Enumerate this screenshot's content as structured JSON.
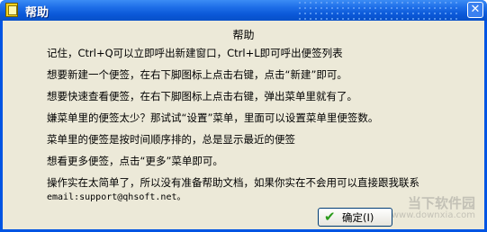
{
  "window": {
    "title": "帮助",
    "close_glyph": "✕"
  },
  "dialog": {
    "heading": "帮助",
    "lines": [
      "记住，Ctrl+Q可以立即呼出新建窗口，Ctrl+L即可呼出便签列表",
      "想要新建一个便签，在右下脚图标上点击右键，点击“新建”即可。",
      "想要快速查看便签，在右下脚图标上点击右键，弹出菜单里就有了。",
      "嫌菜单里的便签太少？那试试“设置”菜单，里面可以设置菜单里便签数。",
      "菜单里的便签是按时间顺序排的，总是显示最近的便签",
      "想看更多便签，点击“更多”菜单即可。",
      "操作实在太简单了，所以没有准备帮助文档，如果你实在不会用可以直接跟我联系",
      "email:support@qhsoft.net。"
    ],
    "ok_button": "确定(I)",
    "ok_icon": "check-icon"
  },
  "watermark": {
    "line1": "当下软件园",
    "line2": "www.downxia.com"
  }
}
